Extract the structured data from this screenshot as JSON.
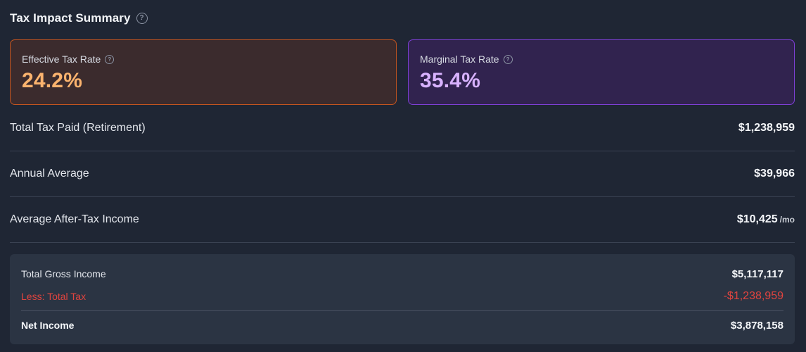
{
  "header": {
    "title": "Tax Impact Summary",
    "help_icon": "question-circle-icon"
  },
  "cards": {
    "effective": {
      "label": "Effective Tax Rate",
      "value": "24.2%",
      "accent_color": "#fbb36e",
      "border_color": "#c2541f"
    },
    "marginal": {
      "label": "Marginal Tax Rate",
      "value": "35.4%",
      "accent_color": "#d8b2ff",
      "border_color": "#7e3fd6"
    }
  },
  "rows": [
    {
      "label": "Total Tax Paid (Retirement)",
      "value": "$1,238,959",
      "unit": ""
    },
    {
      "label": "Annual Average",
      "value": "$39,966",
      "unit": ""
    },
    {
      "label": "Average After-Tax Income",
      "value": "$10,425",
      "unit": "/mo"
    }
  ],
  "breakdown": {
    "gross": {
      "label": "Total Gross Income",
      "value": "$5,117,117"
    },
    "tax": {
      "label": "Less: Total Tax",
      "value": "-$1,238,959",
      "color": "#e0443f"
    },
    "net": {
      "label": "Net Income",
      "value": "$3,878,158"
    }
  }
}
